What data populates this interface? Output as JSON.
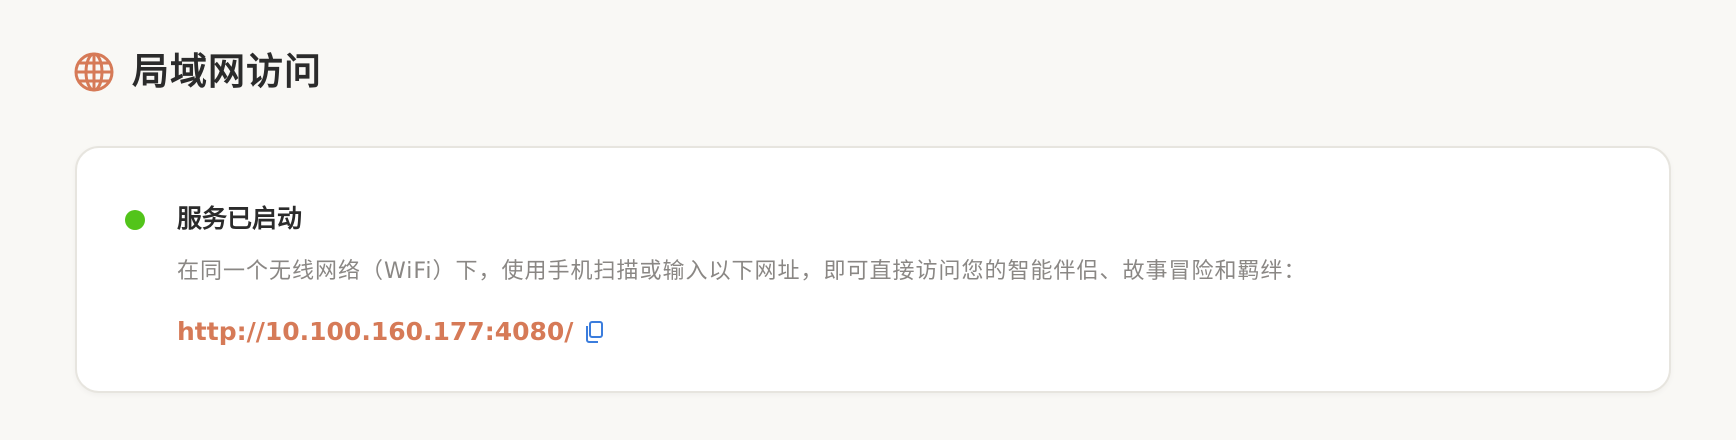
{
  "section": {
    "title": "局域网访问",
    "icon": "globe-icon",
    "icon_color": "#d67a57"
  },
  "status": {
    "title": "服务已启动",
    "indicator_color": "#52c41a",
    "description": "在同一个无线网络（WiFi）下，使用手机扫描或输入以下网址，即可直接访问您的智能伴侣、故事冒险和羁绊：",
    "url": "http://10.100.160.177:4080/",
    "url_color": "#d67a57",
    "copy_icon": "copy-icon",
    "copy_icon_color": "#3b7ddd"
  }
}
